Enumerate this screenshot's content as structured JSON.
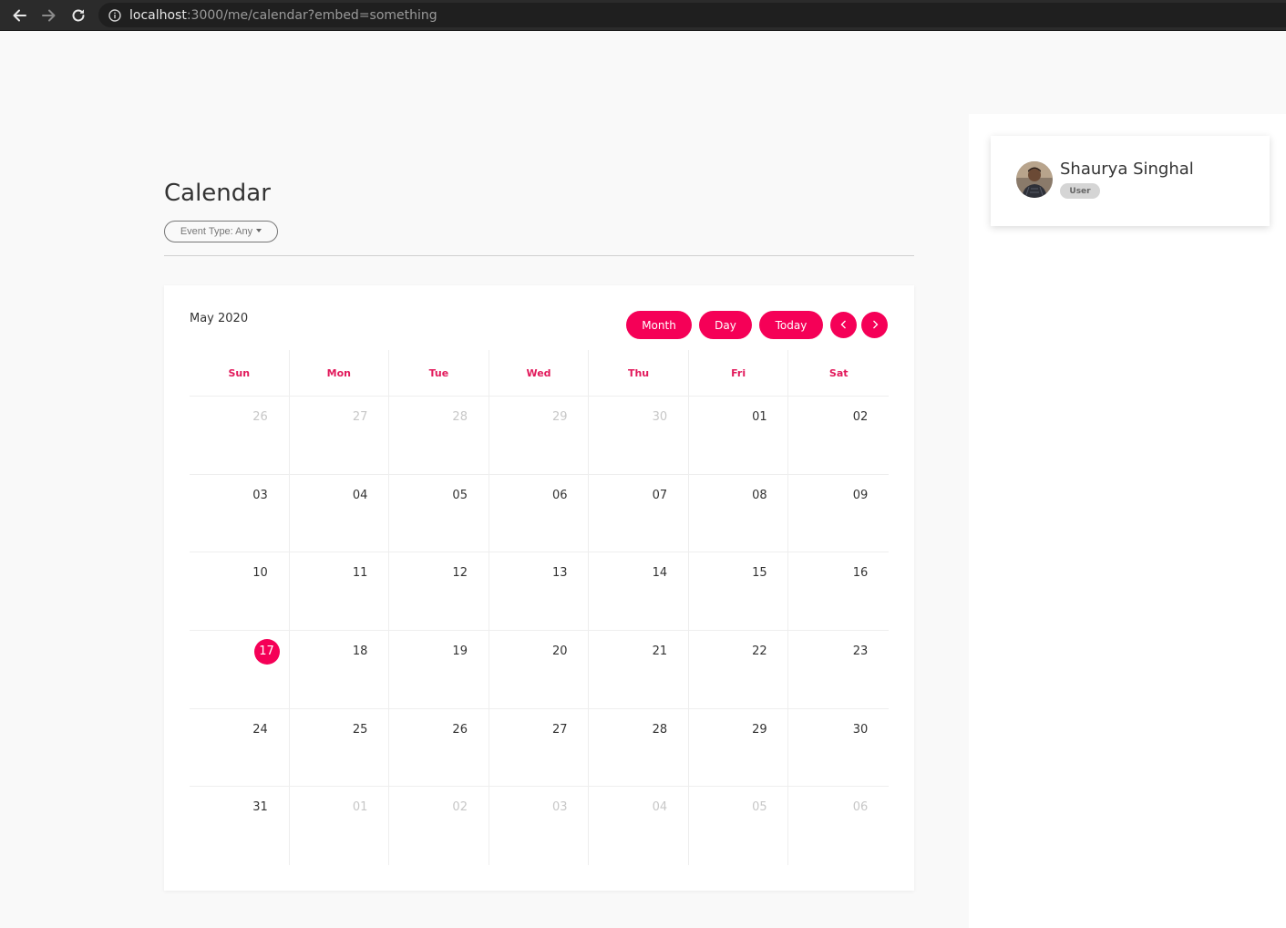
{
  "browser": {
    "url_host": "localhost",
    "url_path": ":3000/me/calendar?embed=something",
    "icons": {
      "back": "back-arrow-icon",
      "forward": "forward-arrow-icon",
      "reload": "reload-icon",
      "info": "info-icon"
    }
  },
  "page": {
    "title": "Calendar",
    "filter_label": "Event Type: Any"
  },
  "calendar": {
    "month_label": "May 2020",
    "buttons": {
      "month": "Month",
      "day": "Day",
      "today": "Today",
      "prev_icon": "chevron-left-icon",
      "next_icon": "chevron-right-icon"
    },
    "weekdays": [
      "Sun",
      "Mon",
      "Tue",
      "Wed",
      "Thu",
      "Fri",
      "Sat"
    ],
    "weeks": [
      [
        {
          "d": "26",
          "out": true
        },
        {
          "d": "27",
          "out": true
        },
        {
          "d": "28",
          "out": true
        },
        {
          "d": "29",
          "out": true
        },
        {
          "d": "30",
          "out": true
        },
        {
          "d": "01"
        },
        {
          "d": "02"
        }
      ],
      [
        {
          "d": "03"
        },
        {
          "d": "04"
        },
        {
          "d": "05"
        },
        {
          "d": "06"
        },
        {
          "d": "07"
        },
        {
          "d": "08"
        },
        {
          "d": "09"
        }
      ],
      [
        {
          "d": "10"
        },
        {
          "d": "11"
        },
        {
          "d": "12"
        },
        {
          "d": "13"
        },
        {
          "d": "14"
        },
        {
          "d": "15"
        },
        {
          "d": "16"
        }
      ],
      [
        {
          "d": "17",
          "today": true
        },
        {
          "d": "18"
        },
        {
          "d": "19"
        },
        {
          "d": "20"
        },
        {
          "d": "21"
        },
        {
          "d": "22"
        },
        {
          "d": "23"
        }
      ],
      [
        {
          "d": "24"
        },
        {
          "d": "25"
        },
        {
          "d": "26"
        },
        {
          "d": "27"
        },
        {
          "d": "28"
        },
        {
          "d": "29"
        },
        {
          "d": "30"
        }
      ],
      [
        {
          "d": "31"
        },
        {
          "d": "01",
          "out": true
        },
        {
          "d": "02",
          "out": true
        },
        {
          "d": "03",
          "out": true
        },
        {
          "d": "04",
          "out": true
        },
        {
          "d": "05",
          "out": true
        },
        {
          "d": "06",
          "out": true
        }
      ]
    ]
  },
  "user": {
    "name": "Shaurya Singhal",
    "role": "User"
  },
  "colors": {
    "accent": "#f50057",
    "weekday_text": "#e2195b",
    "muted_day": "#c7c7c7",
    "page_bg": "#f9f9f9"
  }
}
